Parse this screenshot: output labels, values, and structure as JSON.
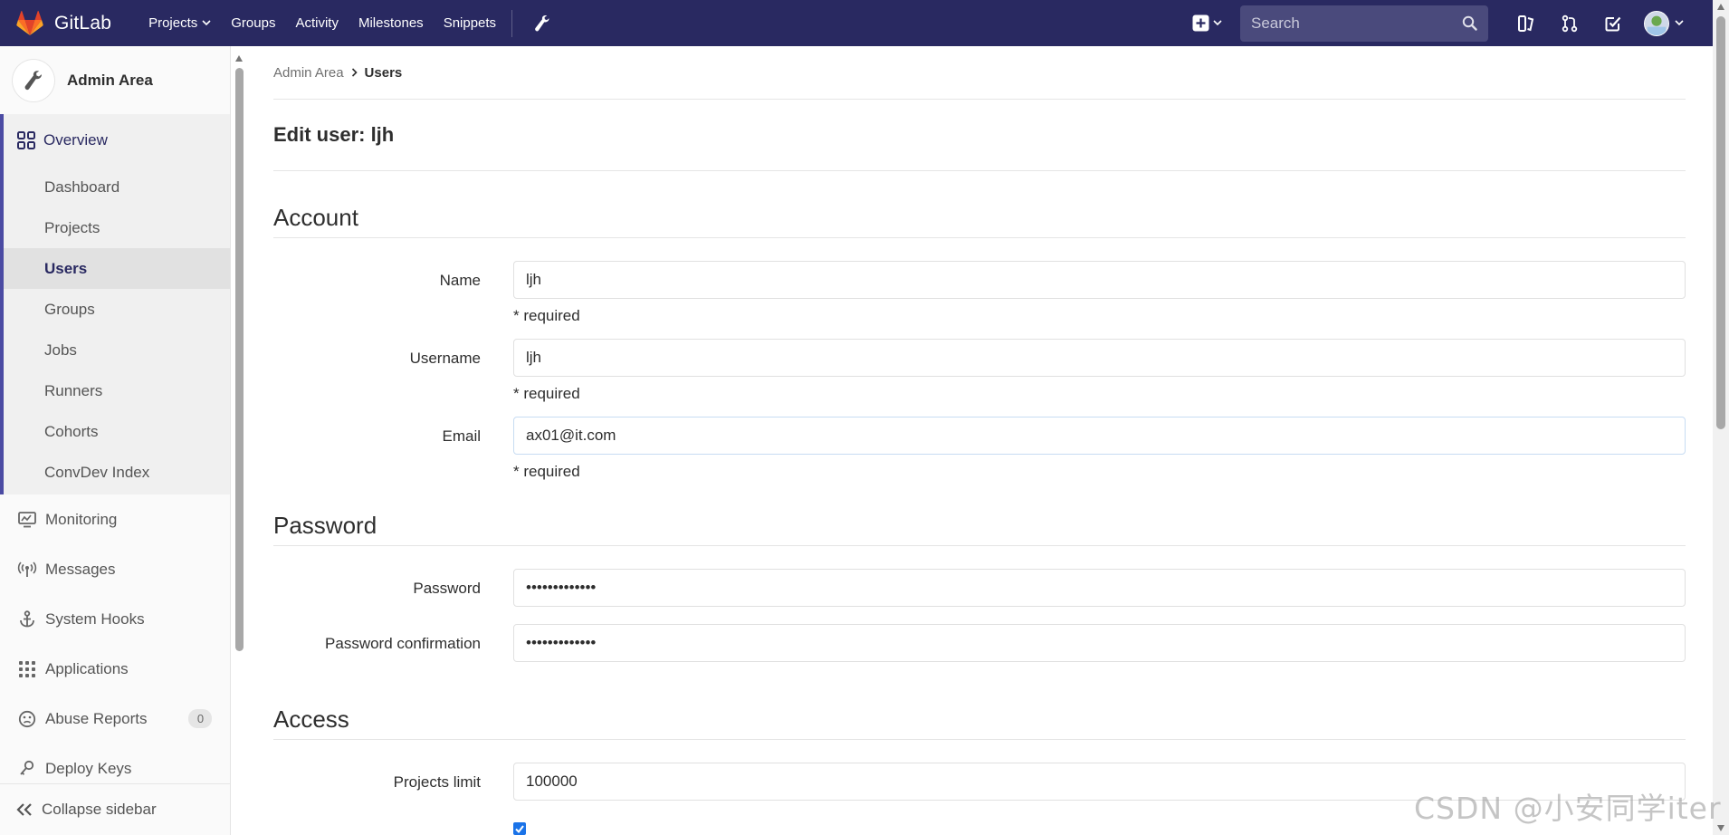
{
  "navbar": {
    "brand": "GitLab",
    "links": [
      {
        "label": "Projects",
        "has_caret": true
      },
      {
        "label": "Groups"
      },
      {
        "label": "Activity"
      },
      {
        "label": "Milestones"
      },
      {
        "label": "Snippets"
      }
    ],
    "search_placeholder": "Search",
    "colors": {
      "background": "#292961",
      "search_bg": "#4a4a7c"
    }
  },
  "sidebar": {
    "title": "Admin Area",
    "overview": {
      "label": "Overview",
      "icon": "grid-icon"
    },
    "overview_items": [
      {
        "label": "Dashboard"
      },
      {
        "label": "Projects"
      },
      {
        "label": "Users",
        "active": true
      },
      {
        "label": "Groups"
      },
      {
        "label": "Jobs"
      },
      {
        "label": "Runners"
      },
      {
        "label": "Cohorts"
      },
      {
        "label": "ConvDev Index"
      }
    ],
    "items": [
      {
        "label": "Monitoring",
        "icon": "monitor-icon"
      },
      {
        "label": "Messages",
        "icon": "broadcast-icon"
      },
      {
        "label": "System Hooks",
        "icon": "anchor-icon"
      },
      {
        "label": "Applications",
        "icon": "apps-grid-icon"
      },
      {
        "label": "Abuse Reports",
        "icon": "face-icon",
        "badge": "0"
      },
      {
        "label": "Deploy Keys",
        "icon": "key-icon"
      }
    ],
    "collapse_label": "Collapse sidebar"
  },
  "breadcrumb": {
    "parent": "Admin Area",
    "current": "Users"
  },
  "page_title": "Edit user: ljh",
  "sections": {
    "account": {
      "title": "Account",
      "name_label": "Name",
      "name_value": "ljh",
      "username_label": "Username",
      "username_value": "ljh",
      "email_label": "Email",
      "email_value": "ax01@it.com",
      "required_text": "* required"
    },
    "password": {
      "title": "Password",
      "password_label": "Password",
      "password_value": "•••••••••••••",
      "confirm_label": "Password confirmation",
      "confirm_value": "•••••••••••••"
    },
    "access": {
      "title": "Access",
      "projects_limit_label": "Projects limit",
      "projects_limit_value": "100000",
      "can_create_group_checked": true
    }
  },
  "watermark": "CSDN @小安同学iter"
}
